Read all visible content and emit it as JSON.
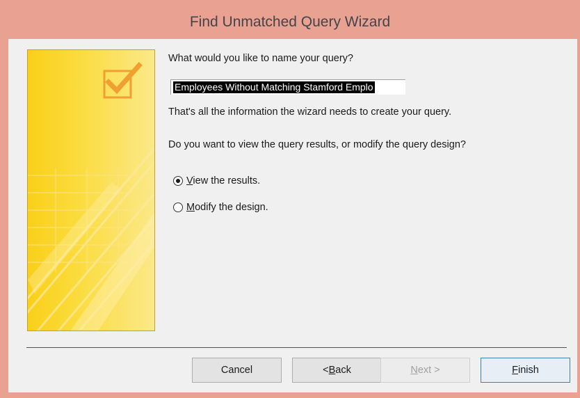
{
  "window": {
    "title": "Find Unmatched Query Wizard"
  },
  "wizard": {
    "name_prompt": "What would you like to name your query?",
    "query_name_value": "Employees Without Matching Stamford Emplo",
    "info_text": "That's all the information the wizard needs to create your query.",
    "view_question": "Do you want to view the query results, or modify the query design?",
    "options": [
      {
        "label_mnemonic": "V",
        "label_rest": "iew the results.",
        "selected": true
      },
      {
        "label_mnemonic": "M",
        "label_rest": "odify the design.",
        "selected": false
      }
    ]
  },
  "buttons": {
    "cancel": "Cancel",
    "back_prefix": "< ",
    "back_mnemonic": "B",
    "back_rest": "ack",
    "next_mnemonic": "N",
    "next_rest": "ext >",
    "finish_mnemonic": "F",
    "finish_rest": "inish"
  },
  "colors": {
    "title_bar": "#e9a291",
    "side_panel": "#f9cf19",
    "accent_orange": "#f0a030",
    "finish_border": "#3c7fb1"
  },
  "icons": {
    "side_panel_checkmark": "checkbox-check-icon"
  }
}
